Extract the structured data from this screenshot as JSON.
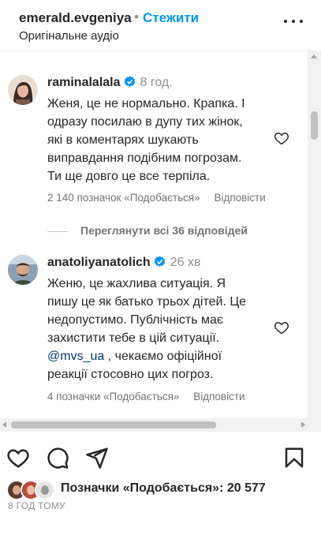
{
  "header": {
    "username": "emerald.evgeniya",
    "separator": "•",
    "follow_label": "Стежити",
    "audio_label": "Оригінальне аудіо",
    "more_icon": "more-horizontal-icon"
  },
  "comments": [
    {
      "username": "raminalalala",
      "verified": true,
      "time": "8 год.",
      "text": "Женя, це не нормально. Крапка. І\nодразу посилаю в дупу тих жінок,\nякі в коментарях шукають\nвиправдання подібним погрозам.\nТи ще довго це все терпіла.",
      "likes_label": "2 140 позначок «Подобається»",
      "reply_label": "Відповісти"
    },
    {
      "username": "anatoliyanatolich",
      "verified": true,
      "time": "26 хв",
      "text_before": "Женю, це жахлива ситуація. Я\nпишу це як батько трьох дітей. Це\nнедопустимо. Публічність має\nзахистити тебе в цій ситуації.\n",
      "mention": "@mvs_ua",
      "text_after": " , чекаємо офіційної\nреакції стосовно цих погроз.",
      "likes_label": "4 позначки «Подобається»",
      "reply_label": "Відповісти"
    }
  ],
  "view_replies_label": "Переглянути всі 36 відповідей",
  "actions": {
    "like_icon": "heart-icon",
    "comment_icon": "comment-icon",
    "share_icon": "send-icon",
    "save_icon": "bookmark-icon"
  },
  "likes": {
    "label": "Позначки «Подобається»:",
    "count": "20 577"
  },
  "posted_ago": "8 ГОД ТОМУ",
  "colors": {
    "link_blue": "#0095f6",
    "text": "#262626",
    "muted": "#737373",
    "verified_blue": "#0095f6"
  }
}
